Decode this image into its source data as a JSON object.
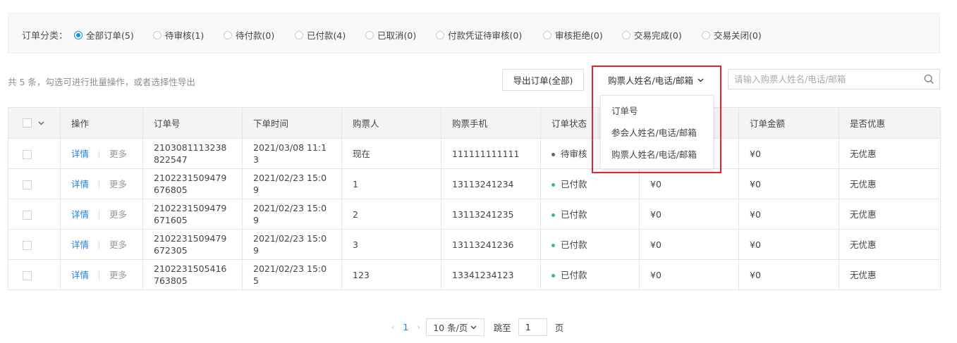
{
  "filter": {
    "label": "订单分类：",
    "options": [
      {
        "label": "全部订单(5)",
        "checked": true
      },
      {
        "label": "待审核(1)",
        "checked": false
      },
      {
        "label": "待付款(0)",
        "checked": false
      },
      {
        "label": "已付款(4)",
        "checked": false
      },
      {
        "label": "已取消(0)",
        "checked": false
      },
      {
        "label": "付款凭证待审核(0)",
        "checked": false
      },
      {
        "label": "审核拒绝(0)",
        "checked": false
      },
      {
        "label": "交易完成(0)",
        "checked": false
      },
      {
        "label": "交易关闭(0)",
        "checked": false
      }
    ]
  },
  "toolbar": {
    "summary": "共 5 条，勾选可进行批量操作，或者选择性导出",
    "export_label": "导出订单(全部)",
    "search_field_selected": "购票人姓名/电话/邮箱",
    "search_field_options": [
      "订单号",
      "参会人姓名/电话/邮箱",
      "购票人姓名/电话/邮箱"
    ],
    "search_placeholder": "请输入购票人姓名/电话/邮箱",
    "search_value": ""
  },
  "table": {
    "headers": [
      "操作",
      "订单号",
      "下单时间",
      "购票人",
      "购票手机",
      "订单状态",
      "",
      "订单金额",
      "是否优惠"
    ],
    "action_detail": "详情",
    "action_more": "更多",
    "rows": [
      {
        "order_no": "2103081113238822547",
        "time": "2021/03/08 11:13",
        "buyer": "现在",
        "phone": "111111111111",
        "status": "待审核",
        "status_color": "#666666",
        "amount_paid": "",
        "amount": "¥0",
        "discount": "无优惠"
      },
      {
        "order_no": "2102231509479676805",
        "time": "2021/02/23 15:09",
        "buyer": "1",
        "phone": "13113241234",
        "status": "已付款",
        "status_color": "#33c36b",
        "amount_paid": "¥0",
        "amount": "¥0",
        "discount": "无优惠"
      },
      {
        "order_no": "2102231509479671605",
        "time": "2021/02/23 15:09",
        "buyer": "2",
        "phone": "13113241235",
        "status": "已付款",
        "status_color": "#33c36b",
        "amount_paid": "¥0",
        "amount": "¥0",
        "discount": "无优惠"
      },
      {
        "order_no": "2102231509479672305",
        "time": "2021/02/23 15:09",
        "buyer": "3",
        "phone": "13113241236",
        "status": "已付款",
        "status_color": "#33c36b",
        "amount_paid": "¥0",
        "amount": "¥0",
        "discount": "无优惠"
      },
      {
        "order_no": "2102231505416763805",
        "time": "2021/02/23 15:05",
        "buyer": "123",
        "phone": "13341234123",
        "status": "已付款",
        "status_color": "#33c36b",
        "amount_paid": "¥0",
        "amount": "¥0",
        "discount": "无优惠"
      }
    ]
  },
  "pagination": {
    "prev": "‹",
    "current_page": "1",
    "next": "›",
    "page_size": "10 条/页",
    "jump_label": "跳至",
    "jump_value": "1",
    "unit": "页"
  },
  "colors": {
    "accent": "#1e7fd8",
    "highlight": "#e8232a",
    "paid_status": "#33c36b"
  }
}
